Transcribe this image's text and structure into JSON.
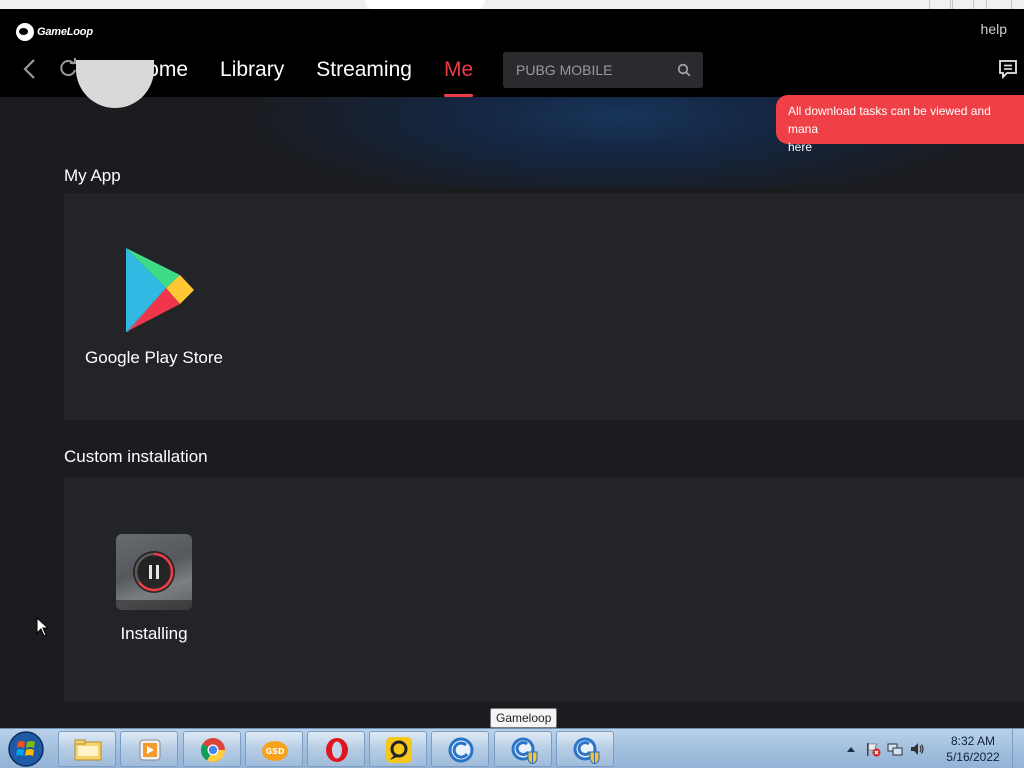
{
  "app": {
    "logo_text": "GameLoop",
    "help_label": "help"
  },
  "nav": {
    "tabs": [
      {
        "label": "Home",
        "active": false
      },
      {
        "label": "Library",
        "active": false
      },
      {
        "label": "Streaming",
        "active": false
      },
      {
        "label": "Me",
        "active": true
      }
    ],
    "search_placeholder": "PUBG MOBILE",
    "accent_color": "#ee3b46"
  },
  "toast": {
    "text": "All download tasks can be viewed and mana here",
    "line1": "All download tasks can be viewed and mana",
    "line2": "here",
    "color": "#f04047"
  },
  "my_app": {
    "title": "My App",
    "apps": [
      {
        "label": "Google Play Store",
        "icon": "google-play-icon"
      }
    ]
  },
  "custom_installation": {
    "title": "Custom installation",
    "apps": [
      {
        "label": "Installing",
        "icon": "installing-thumbnail",
        "state": "paused"
      }
    ]
  },
  "taskbar": {
    "tooltip": "Gameloop",
    "items": [
      {
        "name": "file-explorer",
        "icon": "folder-icon"
      },
      {
        "name": "media-player",
        "icon": "media-player-icon"
      },
      {
        "name": "chrome",
        "icon": "chrome-icon"
      },
      {
        "name": "gsd",
        "icon": "gsd-icon"
      },
      {
        "name": "opera",
        "icon": "opera-icon"
      },
      {
        "name": "ld-player",
        "icon": "ldplayer-icon"
      },
      {
        "name": "gameloop-1",
        "icon": "gameloop-icon"
      },
      {
        "name": "gameloop-2",
        "icon": "gameloop-shield-icon"
      },
      {
        "name": "gameloop-3",
        "icon": "gameloop-shield-icon"
      }
    ],
    "clock_time": "8:32 AM",
    "clock_date": "5/16/2022"
  }
}
